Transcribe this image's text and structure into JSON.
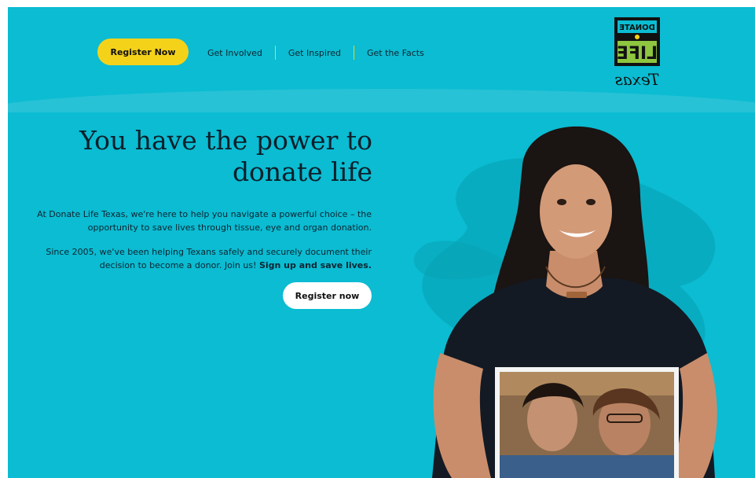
{
  "header": {
    "cta_label": "Register Now",
    "nav": [
      {
        "label": "Get Involved"
      },
      {
        "label": "Get Inspired"
      },
      {
        "label": "Get the Facts"
      }
    ],
    "logo": {
      "line1": "DONATE",
      "line2": "LIFE",
      "script": "Texas"
    }
  },
  "hero": {
    "title": "You have the power to donate life",
    "paragraph1": "At Donate Life Texas, we're here to help you navigate a powerful choice – the opportunity to save lives through tissue, eye and organ donation.",
    "paragraph2": "Since 2005, we've been helping Texans safely and securely document their decision to become a donor. Join us!",
    "paragraph2_bold": "Sign up and save lives.",
    "button_label": "Register now"
  },
  "colors": {
    "background": "#0bbcd2",
    "accent_yellow": "#f5d21a",
    "text_dark": "#0c1f2a"
  },
  "icons": [
    "donate-life-texas-logo"
  ]
}
